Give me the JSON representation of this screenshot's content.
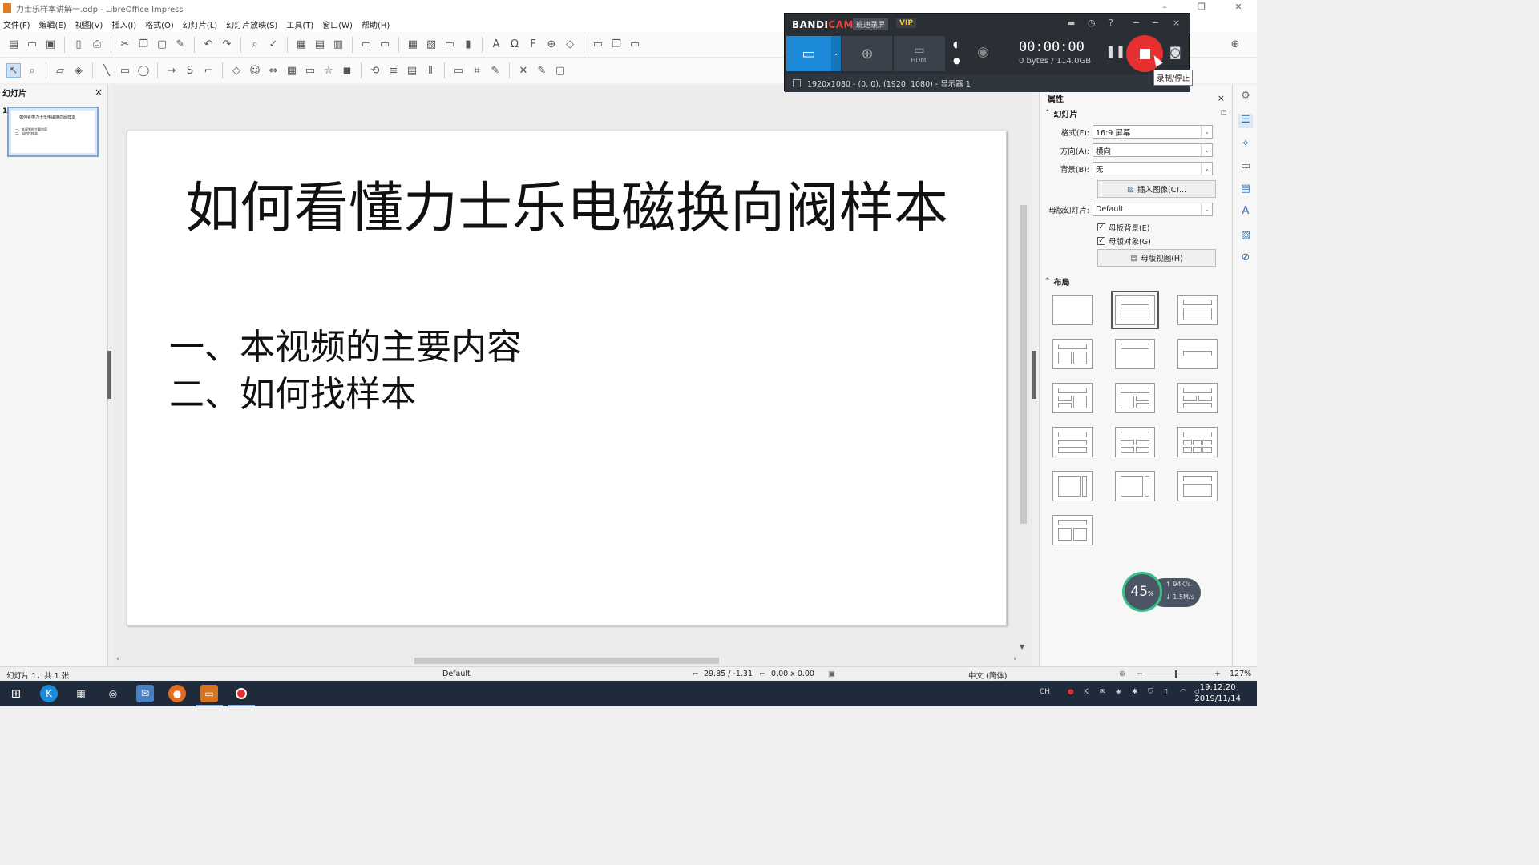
{
  "window": {
    "title": "力士乐样本讲解一.odp - LibreOffice Impress",
    "controls": [
      "–",
      "❐",
      "✕"
    ]
  },
  "menu": [
    "文件(F)",
    "编辑(E)",
    "视图(V)",
    "插入(I)",
    "格式(O)",
    "幻灯片(L)",
    "幻灯片放映(S)",
    "工具(T)",
    "窗口(W)",
    "帮助(H)"
  ],
  "slides_pane": {
    "title": "幻灯片",
    "close": "×",
    "thumbnail_number": "1"
  },
  "slide": {
    "title": "如何看懂力士乐电磁换向阀样本",
    "bullets": [
      "一、本视频的主要内容",
      "二、如何找样本"
    ]
  },
  "properties": {
    "panel_title": "属性",
    "section_slide": "幻灯片",
    "format_label": "格式(F):",
    "format_value": "16:9 屏幕",
    "orientation_label": "方向(A):",
    "orientation_value": "横向",
    "background_label": "背景(B):",
    "background_value": "无",
    "insert_image_button": "插入图像(C)...",
    "master_slide_label": "母版幻灯片:",
    "master_slide_value": "Default",
    "master_background_checkbox": "母板背景(E)",
    "master_objects_checkbox": "母版对象(G)",
    "master_view_button": "母版视图(H)",
    "section_layout": "布局"
  },
  "statusbar": {
    "slide_info": "幻灯片 1，共 1 张",
    "master_name": "Default",
    "position": "29.85 / -1.31",
    "size": "0.00 x 0.00",
    "language": "中文 (简体)",
    "zoom": "127%"
  },
  "bandicam": {
    "logo_prefix": "BANDI",
    "logo_suffix": "CAM",
    "brand_cn": "班迪录屏",
    "vip": "VIP",
    "hdmi_label": "HDMI",
    "timer": "00:00:00",
    "file_size": "0 bytes / 114.0GB",
    "region_info": "1920x1080 - (0, 0), (1920, 1080) - 显示器 1",
    "tooltip": "录制/停止"
  },
  "net_monitor": {
    "percent": "45",
    "percent_unit": "%",
    "upload": "94K/s",
    "download": "1.5M/s"
  },
  "taskbar": {
    "ime": "CH",
    "time": "19:12:20",
    "date": "2019/11/14"
  },
  "colors": {
    "record_button": "#e62f2f",
    "bandicam_bg": "#2a2f36",
    "taskbar_bg": "#1f2a3a",
    "accent_blue": "#1c8ad8"
  }
}
